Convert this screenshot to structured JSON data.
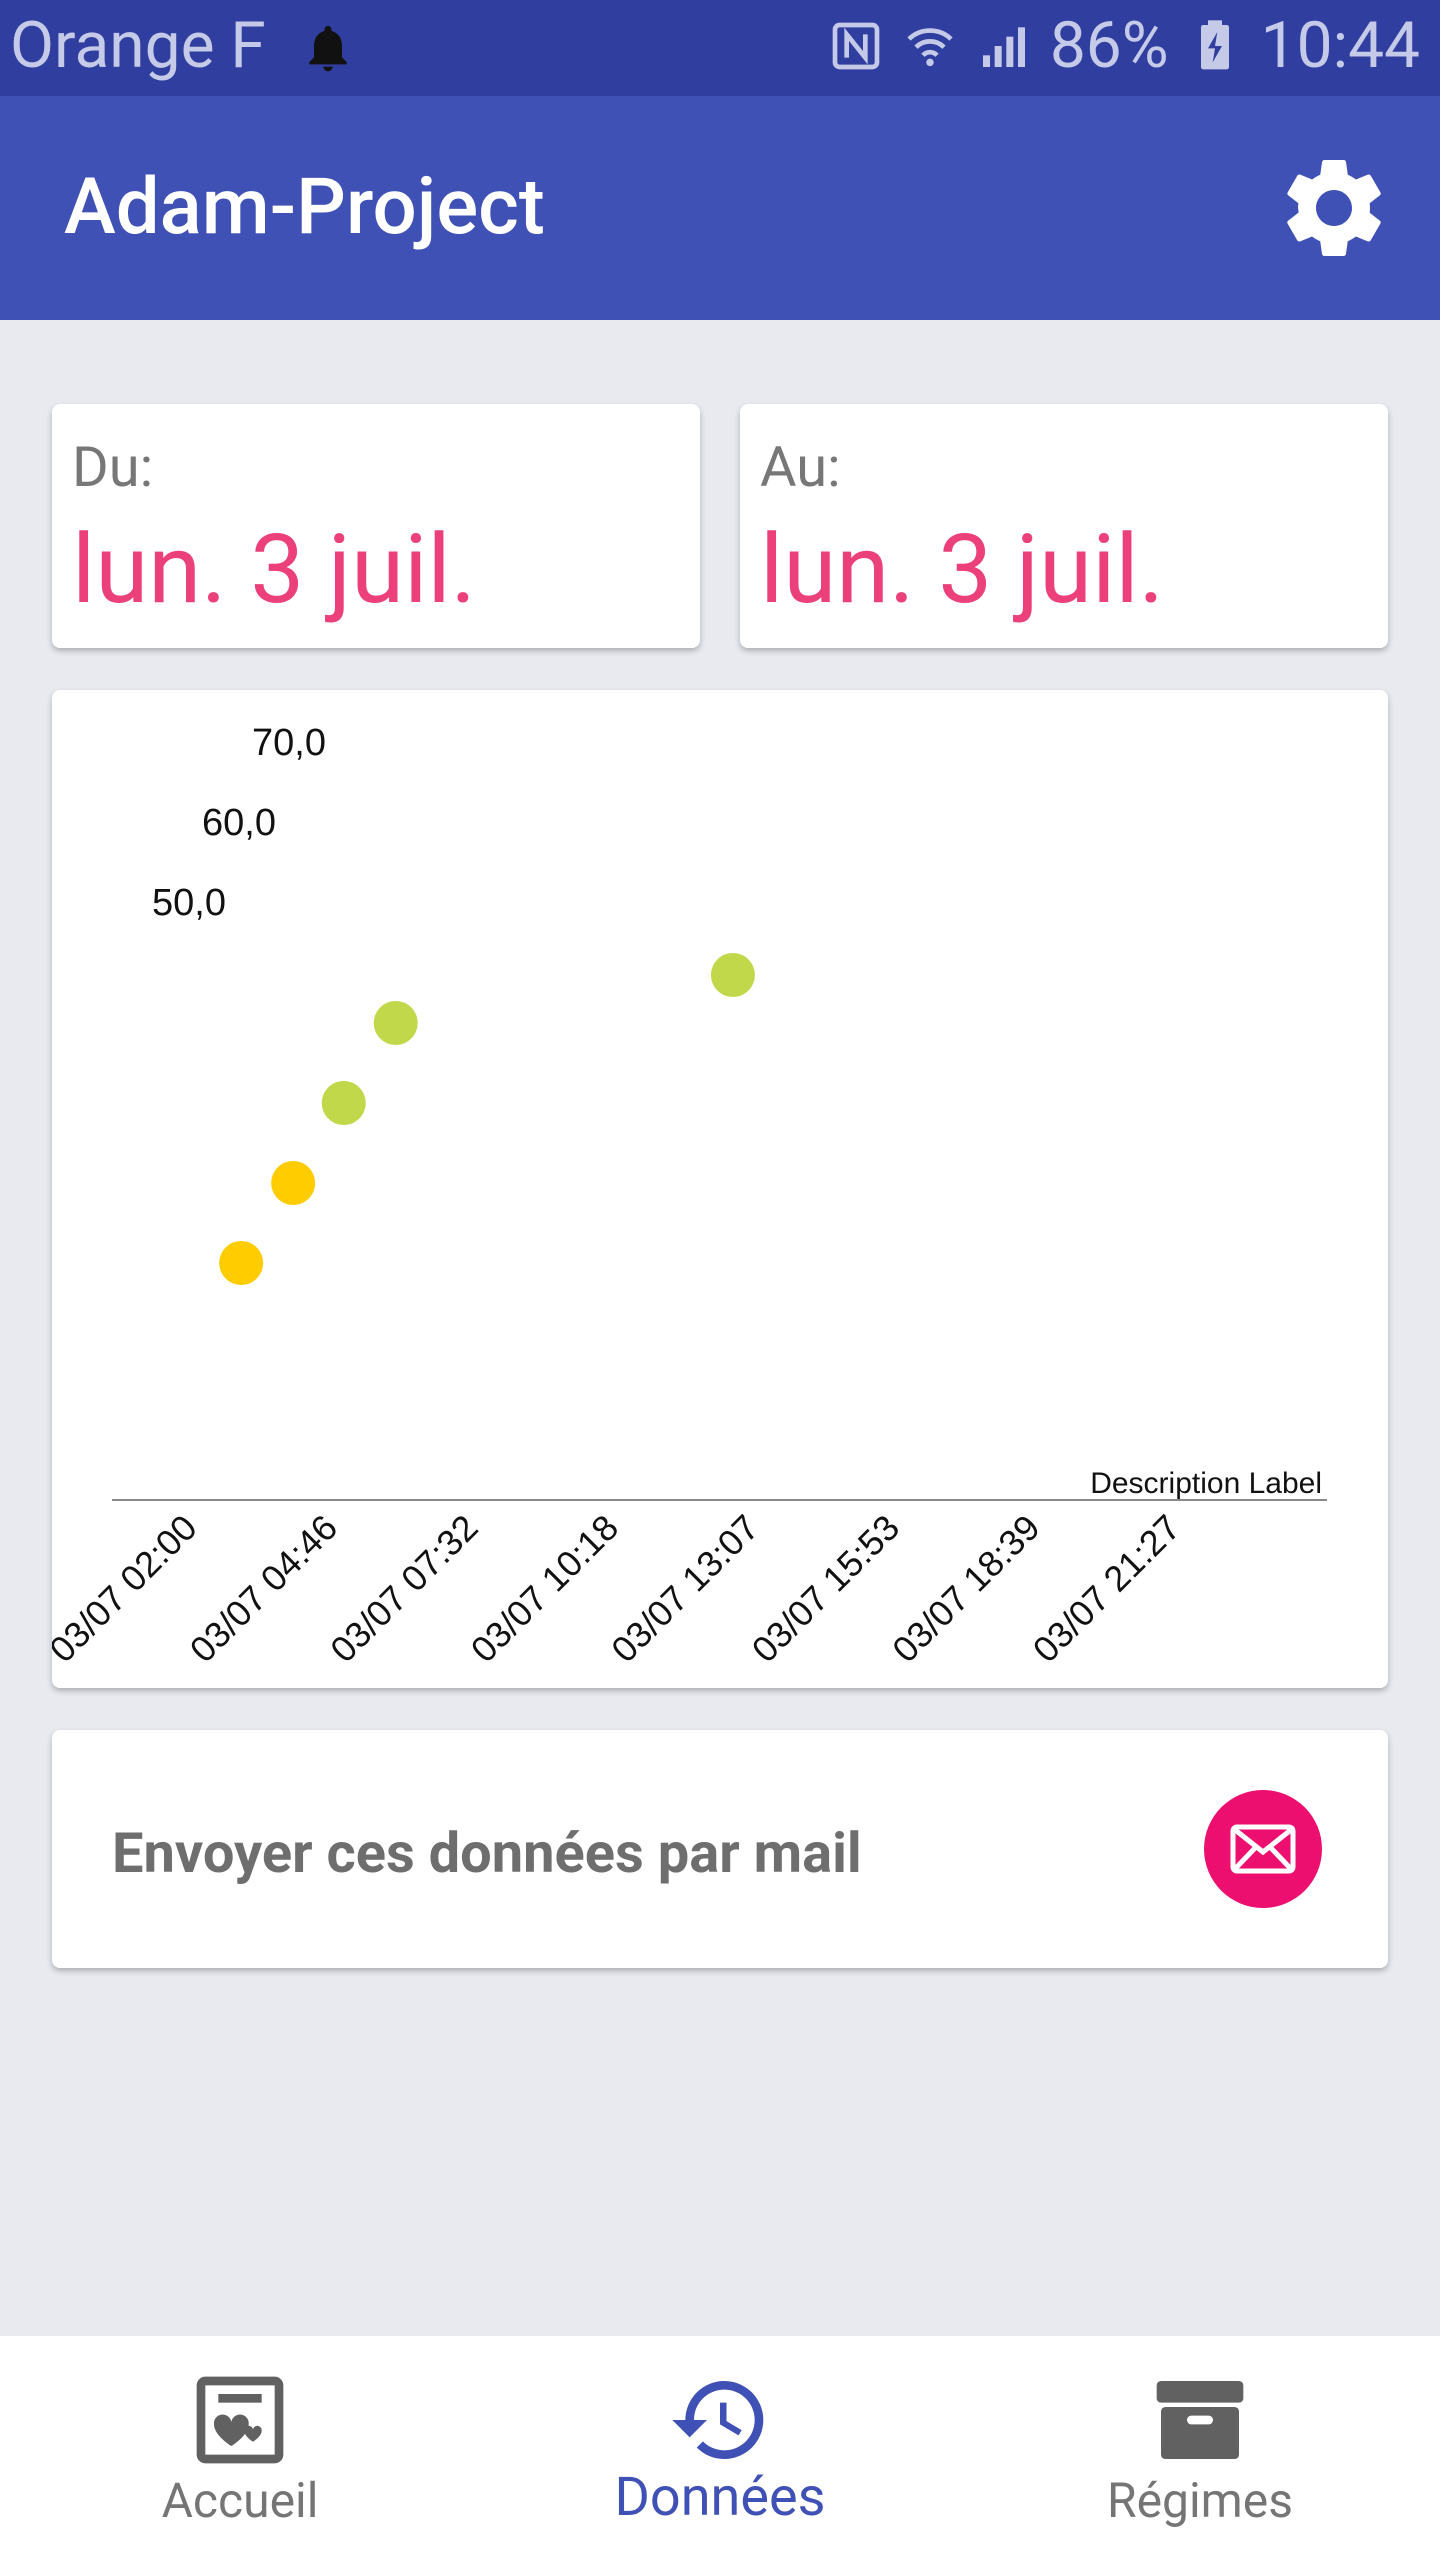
{
  "status_bar": {
    "carrier": "Orange F",
    "battery": "86%",
    "time": "10:44"
  },
  "app_bar": {
    "title": "Adam-Project",
    "settings_icon": "gear-icon"
  },
  "date_range": {
    "from_label": "Du:",
    "from_value": "lun. 3 juil.",
    "to_label": "Au:",
    "to_value": "lun. 3 juil."
  },
  "chart_data": {
    "type": "scatter",
    "description_label": "Description Label",
    "x_tick_labels": [
      "03/07 02:00",
      "03/07 04:46",
      "03/07 07:32",
      "03/07 10:18",
      "03/07 13:07",
      "03/07 15:53",
      "03/07 18:39",
      "03/07 21:27"
    ],
    "y_tick_labels": [
      "50,0",
      "60,0",
      "70,0"
    ],
    "colors": {
      "yellow": "#ffcc00",
      "green": "#c0d84a"
    },
    "series": [
      {
        "color": "#ffcc00",
        "points": [
          {
            "tick": 0.35,
            "y": 30
          },
          {
            "tick": 0.72,
            "y": 40
          }
        ]
      },
      {
        "color": "#c0d84a",
        "points": [
          {
            "tick": 1.08,
            "y": 50
          },
          {
            "tick": 1.45,
            "y": 60
          },
          {
            "tick": 3.85,
            "y": 66
          }
        ]
      }
    ]
  },
  "mail": {
    "label": "Envoyer ces données par mail",
    "icon": "mail-icon",
    "accent": "#ec0f6f"
  },
  "bottom_nav": {
    "items": [
      {
        "label": "Accueil",
        "icon": "journal-heart-icon",
        "active": false
      },
      {
        "label": "Données",
        "icon": "history-icon",
        "active": true
      },
      {
        "label": "Régimes",
        "icon": "archive-box-icon",
        "active": false
      }
    ],
    "active_color": "#3f51b5"
  }
}
